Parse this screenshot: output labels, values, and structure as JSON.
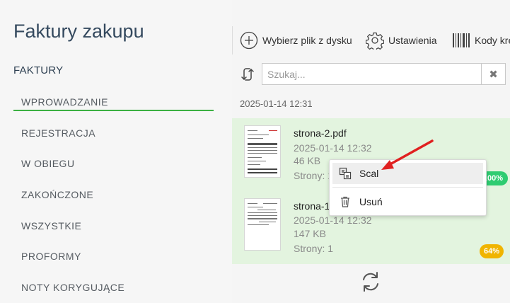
{
  "sidebar": {
    "title": "Faktury zakupu",
    "section": "FAKTURY",
    "items": [
      {
        "label": "WPROWADZANIE",
        "active": true
      },
      {
        "label": "REJESTRACJA"
      },
      {
        "label": "W OBIEGU"
      },
      {
        "label": "ZAKOŃCZONE"
      },
      {
        "label": "WSZYSTKIE"
      },
      {
        "label": "PROFORMY"
      },
      {
        "label": "NOTY KORYGUJĄCE"
      }
    ],
    "accent": "#3cb043"
  },
  "toolbar": {
    "choose_file": "Wybierz plik z dysku",
    "settings": "Ustawienia",
    "barcodes": "Kody kre"
  },
  "search": {
    "placeholder": "Szukaj...",
    "value": ""
  },
  "group": {
    "date": "2025-01-14 12:31"
  },
  "files": [
    {
      "name": "strona-2.pdf",
      "date": "2025-01-14 12:32",
      "size": "46 KB",
      "pages": "Strony: 1",
      "progress": "100%",
      "badge_color": "#2ecc71"
    },
    {
      "name": "strona-1",
      "date": "2025-01-14 12:32",
      "size": "147 KB",
      "pages": "Strony: 1",
      "progress": "64%",
      "badge_color": "#f0b400"
    }
  ],
  "context_menu": {
    "merge": "Scal",
    "delete": "Usuń"
  },
  "colors": {
    "highlight_bg": "#e3f4df",
    "arrow": "#e02020"
  }
}
